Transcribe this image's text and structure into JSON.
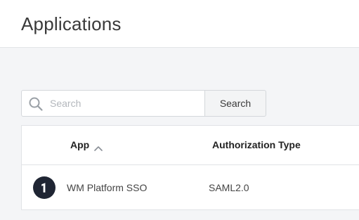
{
  "header": {
    "title": "Applications"
  },
  "search": {
    "placeholder": "Search",
    "value": "",
    "button_label": "Search"
  },
  "table": {
    "columns": [
      {
        "label": "App",
        "sort": "ascending"
      },
      {
        "label": "Authorization Type"
      }
    ],
    "rows": [
      {
        "app_name": "WM Platform SSO",
        "auth_type": "SAML2.0",
        "logo_icon": "webmethods-logo-icon"
      }
    ]
  },
  "colors": {
    "page_background": "#f4f5f7",
    "logo_background": "#1f2533"
  }
}
